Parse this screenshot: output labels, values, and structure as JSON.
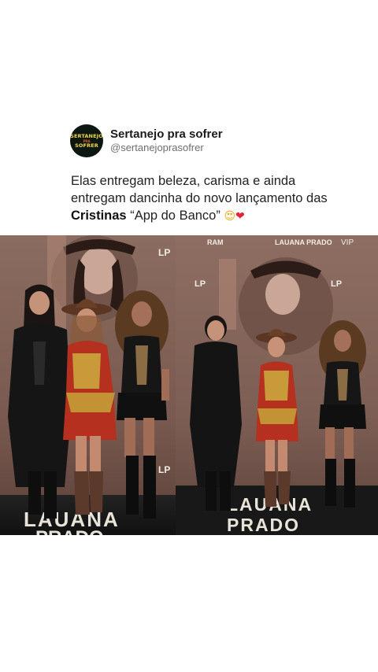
{
  "post": {
    "avatar_text": {
      "line1": "SERTANEJO",
      "line2": "PRA",
      "line3": "SOFRER"
    },
    "display_name": "Sertanejo pra sofrer",
    "handle": "@sertanejoprasofrer",
    "text_part1": "Elas entregam beleza, carisma e ainda entregam dancinha do novo lançamento das ",
    "text_bold": "Cristinas",
    "text_part2": " “App do Banco” ",
    "emoji_1": "😍",
    "emoji_2": "❤"
  },
  "photos": {
    "left": {
      "backdrop_logo": "LP",
      "floor_text_line1": "LAUANA",
      "floor_text_line2": "PRADO"
    },
    "right": {
      "backdrop_logo": "LP",
      "backdrop_brand": "RAM",
      "backdrop_name": "LAUANA PRADO",
      "backdrop_vip": "VIP",
      "floor_text_line1": "LAUANA",
      "floor_text_line2": "PRADO"
    }
  },
  "colors": {
    "backdrop": "#8a6a5e",
    "floor": "#1a1a1a",
    "floor_text": "#e9e4da"
  }
}
